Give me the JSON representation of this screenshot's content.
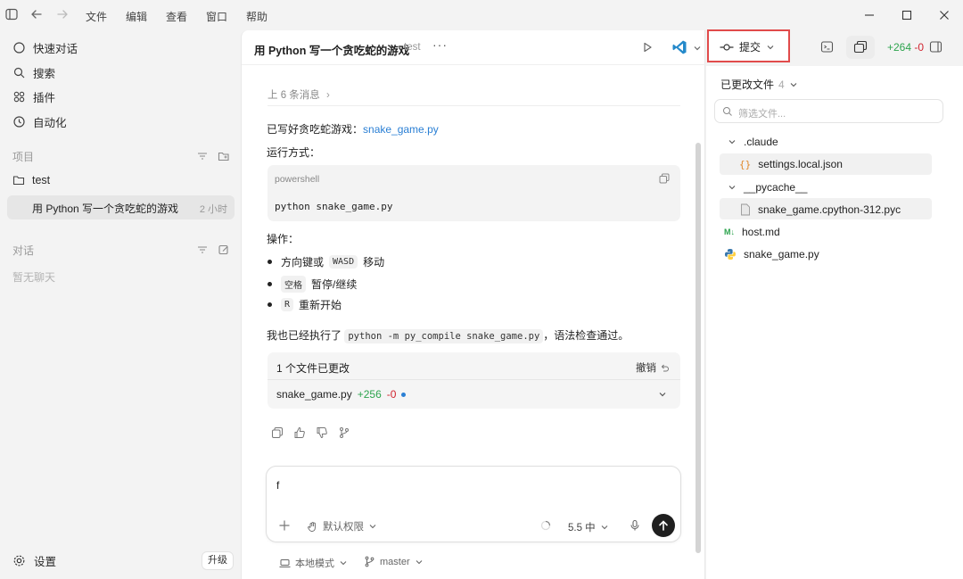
{
  "menu": [
    "文件",
    "编辑",
    "查看",
    "窗口",
    "帮助"
  ],
  "sidebar": {
    "nav": [
      {
        "label": "快速对话",
        "icon": "chat-circle-icon"
      },
      {
        "label": "搜索",
        "icon": "search-icon"
      },
      {
        "label": "插件",
        "icon": "plugin-grid-icon"
      },
      {
        "label": "自动化",
        "icon": "clock-icon"
      }
    ],
    "projects_title": "项目",
    "project_name": "test",
    "chat_title": "用 Python 写一个贪吃蛇的游戏",
    "chat_time": "2 小时",
    "conversations_title": "对话",
    "empty_text": "暂无聊天",
    "settings_label": "设置",
    "upgrade_label": "升级"
  },
  "chat": {
    "title": "用 Python 写一个贪吃蛇的游戏",
    "project": "test",
    "more": "···",
    "prev_messages": "上 6 条消息",
    "written_prefix": "已写好贪吃蛇游戏：",
    "written_file": "snake_game.py",
    "run_label": "运行方式：",
    "code_lang": "powershell",
    "code_text": "python snake_game.py",
    "ops_label": "操作：",
    "bullets": [
      {
        "pre": "方向键或",
        "key": "WASD",
        "post": "移动"
      },
      {
        "pre": "",
        "key": "空格",
        "post": "暂停/继续"
      },
      {
        "pre": "",
        "key": "R",
        "post": "重新开始"
      }
    ],
    "check_prefix": "我也已经执行了",
    "check_code": "python -m py_compile snake_game.py",
    "check_suffix": "，语法检查通过。",
    "changes_title": "1 个文件已更改",
    "undo_label": "撤销",
    "changed_file": "snake_game.py",
    "changed_plus": "+256",
    "changed_minus": "-0",
    "input_value": "f",
    "permission_label": "默认权限",
    "model_label": "5.5 中",
    "mode_label": "本地模式",
    "branch_label": "master"
  },
  "toolbar": {
    "commit_label": "提交",
    "diff_plus": "+264",
    "diff_minus": "-0"
  },
  "right_panel": {
    "title": "已更改文件",
    "count": "4",
    "filter_placeholder": "筛选文件...",
    "tree": [
      {
        "label": ".claude",
        "type": "folder"
      },
      {
        "label": "settings.local.json",
        "type": "json"
      },
      {
        "label": "__pycache__",
        "type": "folder"
      },
      {
        "label": "snake_game.cpython-312.pyc",
        "type": "file"
      },
      {
        "label": "host.md",
        "type": "markdown"
      },
      {
        "label": "snake_game.py",
        "type": "python"
      }
    ]
  },
  "colors": {
    "accent_blue": "#2a7fd4",
    "add_green": "#2da44e",
    "del_red": "#d1242f",
    "highlight_red": "#e14b4b"
  }
}
